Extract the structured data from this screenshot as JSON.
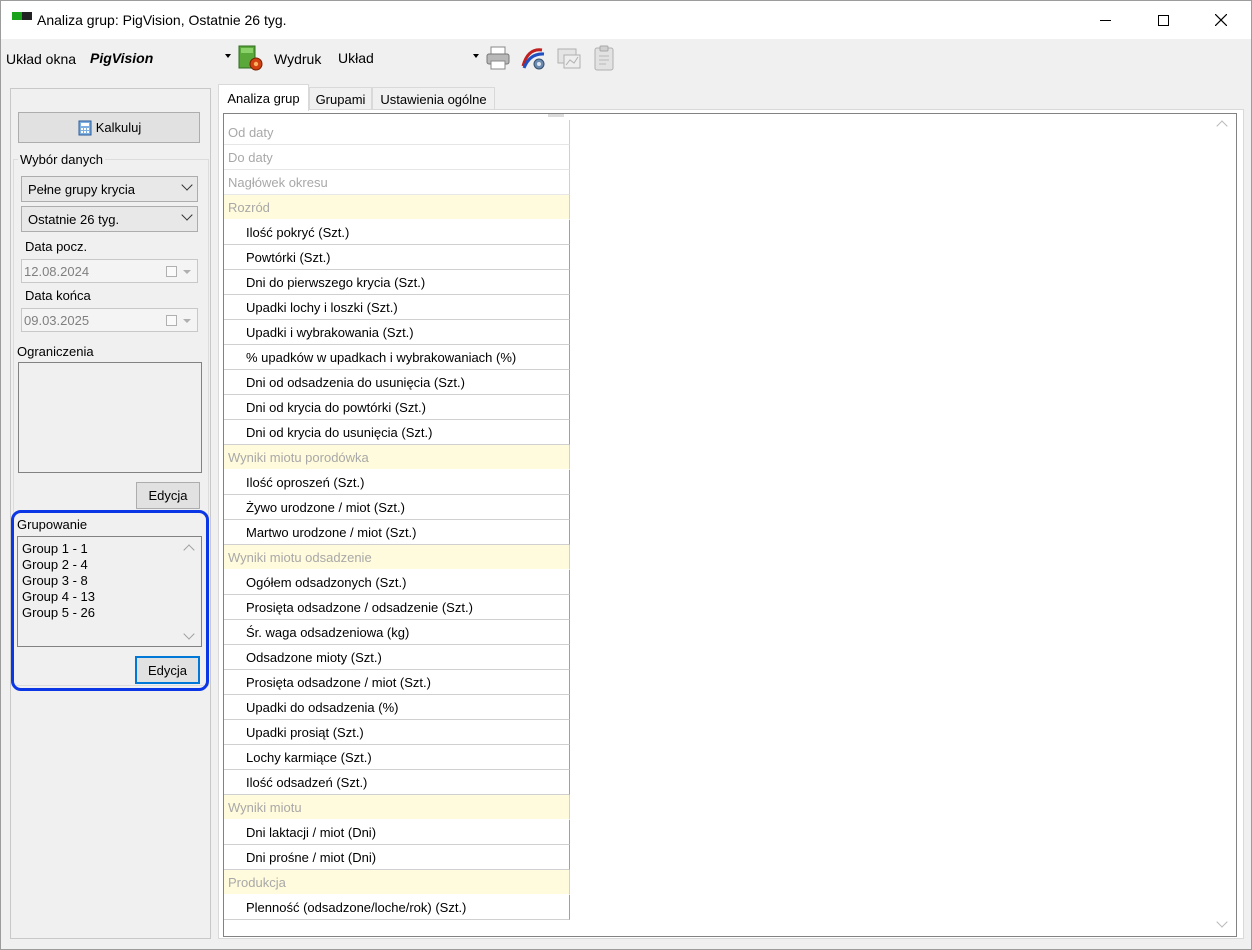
{
  "window": {
    "title": "Analiza grup: PigVision, Ostatnie 26 tyg."
  },
  "toolbar": {
    "layout_label": "Układ okna",
    "layout_value": "PigVision",
    "print_label": "Wydruk",
    "print_value": "Układ"
  },
  "left": {
    "calc_button": "Kalkuluj",
    "data_selection_label": "Wybór danych",
    "combo1": "Pełne grupy krycia",
    "combo2": "Ostatnie 26 tyg.",
    "start_label": "Data pocz.",
    "start_value": "12.08.2024",
    "end_label": "Data końca",
    "end_value": "09.03.2025",
    "restrictions_label": "Ograniczenia",
    "restrictions_edit": "Edycja",
    "grouping_label": "Grupowanie",
    "groups": [
      "Group 1 - 1",
      "Group 2 - 4",
      "Group 3 - 8",
      "Group 4 - 13",
      "Group 5 - 26"
    ],
    "grouping_edit": "Edycja"
  },
  "tabs": [
    "Analiza grup",
    "Grupami",
    "Ustawienia ogólne"
  ],
  "grid": {
    "rows": [
      {
        "type": "hdr",
        "text": "Od daty"
      },
      {
        "type": "hdr",
        "text": "Do daty"
      },
      {
        "type": "hdr",
        "text": "Nagłówek okresu"
      },
      {
        "type": "sec",
        "text": "Rozród"
      },
      {
        "type": "item",
        "text": "Ilość pokryć (Szt.)"
      },
      {
        "type": "item",
        "text": "Powtórki (Szt.)"
      },
      {
        "type": "item",
        "text": "Dni do pierwszego krycia (Szt.)"
      },
      {
        "type": "item",
        "text": "Upadki lochy i loszki (Szt.)"
      },
      {
        "type": "item",
        "text": "Upadki i wybrakowania (Szt.)"
      },
      {
        "type": "item",
        "text": "% upadków w upadkach i wybrakowaniach (%)"
      },
      {
        "type": "item",
        "text": "Dni od odsadzenia do usunięcia (Szt.)"
      },
      {
        "type": "item",
        "text": "Dni od krycia do powtórki (Szt.)"
      },
      {
        "type": "item",
        "text": "Dni od krycia do usunięcia (Szt.)"
      },
      {
        "type": "sec",
        "text": "Wyniki miotu porodówka"
      },
      {
        "type": "item",
        "text": "Ilość oproszeń (Szt.)"
      },
      {
        "type": "item",
        "text": "Żywo urodzone / miot (Szt.)"
      },
      {
        "type": "item",
        "text": "Martwo urodzone / miot (Szt.)"
      },
      {
        "type": "sec",
        "text": "Wyniki miotu odsadzenie"
      },
      {
        "type": "item",
        "text": "Ogółem odsadzonych (Szt.)"
      },
      {
        "type": "item",
        "text": "Prosięta odsadzone / odsadzenie (Szt.)"
      },
      {
        "type": "item",
        "text": "Śr. waga odsadzeniowa (kg)"
      },
      {
        "type": "item",
        "text": "Odsadzone mioty (Szt.)"
      },
      {
        "type": "item",
        "text": "Prosięta odsadzone / miot (Szt.)"
      },
      {
        "type": "item",
        "text": "Upadki do odsadzenia (%)"
      },
      {
        "type": "item",
        "text": "Upadki prosiąt (Szt.)"
      },
      {
        "type": "item",
        "text": "Lochy karmiące (Szt.)"
      },
      {
        "type": "item",
        "text": "Ilość odsadzeń (Szt.)"
      },
      {
        "type": "sec",
        "text": "Wyniki miotu"
      },
      {
        "type": "item",
        "text": "Dni laktacji / miot (Dni)"
      },
      {
        "type": "item",
        "text": "Dni prośne / miot (Dni)"
      },
      {
        "type": "sec",
        "text": "Produkcja"
      },
      {
        "type": "item",
        "text": "Plenność (odsadzone/loche/rok) (Szt.)"
      }
    ]
  }
}
